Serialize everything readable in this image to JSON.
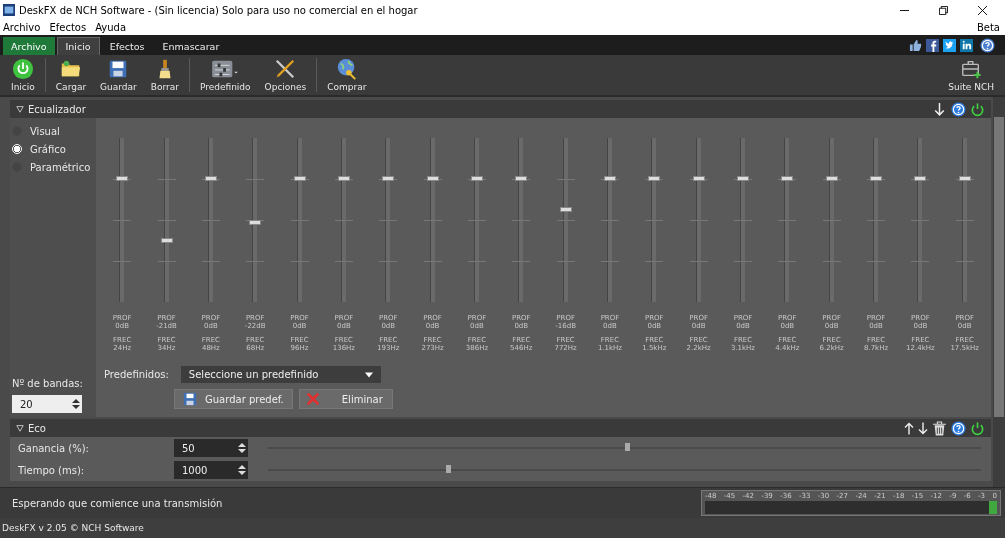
{
  "window": {
    "title": "DeskFX de NCH Software - (Sin licencia) Solo para uso no comercial en el hogar",
    "badge": "Beta"
  },
  "menu": [
    "Archivo",
    "Efectos",
    "Ayuda"
  ],
  "tabs": [
    {
      "label": "Archivo",
      "kind": "file",
      "selected": false
    },
    {
      "label": "Inicio",
      "kind": "tab",
      "selected": true
    },
    {
      "label": "Efectos",
      "kind": "tab",
      "selected": false
    },
    {
      "label": "Enmascarar",
      "kind": "tab",
      "selected": false
    }
  ],
  "toolbar": [
    {
      "label": "Inicio"
    },
    {
      "label": "Cargar"
    },
    {
      "label": "Guardar"
    },
    {
      "label": "Borrar"
    },
    {
      "label": "Predefinido"
    },
    {
      "label": "Opciones"
    },
    {
      "label": "Comprar"
    }
  ],
  "suite": "Suite NCH",
  "equalizer": {
    "title": "Ecualizador",
    "modes": [
      {
        "label": "Visual",
        "selected": false
      },
      {
        "label": "Gráfico",
        "selected": true
      },
      {
        "label": "Paramétrico",
        "selected": false
      }
    ],
    "bands_label": "Nº de bandas:",
    "bands_value": "20",
    "presets_label": "Predefinidos:",
    "presets_placeholder": "Seleccione un predefinido",
    "save_button": "Guardar predef.",
    "delete_button": "Eliminar",
    "bands": [
      {
        "gain_label": "PROF",
        "gain": "0dB",
        "freq_label": "FREC",
        "freq": "24Hz",
        "level": 0.75
      },
      {
        "gain_label": "PROF",
        "gain": "-21dB",
        "freq_label": "FREC",
        "freq": "34Hz",
        "level": 0.37
      },
      {
        "gain_label": "PROF",
        "gain": "0dB",
        "freq_label": "FREC",
        "freq": "48Hz",
        "level": 0.75
      },
      {
        "gain_label": "PROF",
        "gain": "-22dB",
        "freq_label": "FREC",
        "freq": "68Hz",
        "level": 0.48
      },
      {
        "gain_label": "PROF",
        "gain": "0dB",
        "freq_label": "FREC",
        "freq": "96Hz",
        "level": 0.75
      },
      {
        "gain_label": "PROF",
        "gain": "0dB",
        "freq_label": "FREC",
        "freq": "136Hz",
        "level": 0.75
      },
      {
        "gain_label": "PROF",
        "gain": "0dB",
        "freq_label": "FREC",
        "freq": "193Hz",
        "level": 0.75
      },
      {
        "gain_label": "PROF",
        "gain": "0dB",
        "freq_label": "FREC",
        "freq": "273Hz",
        "level": 0.75
      },
      {
        "gain_label": "PROF",
        "gain": "0dB",
        "freq_label": "FREC",
        "freq": "386Hz",
        "level": 0.75
      },
      {
        "gain_label": "PROF",
        "gain": "0dB",
        "freq_label": "FREC",
        "freq": "546Hz",
        "level": 0.75
      },
      {
        "gain_label": "PROF",
        "gain": "-16dB",
        "freq_label": "FREC",
        "freq": "772Hz",
        "level": 0.56
      },
      {
        "gain_label": "PROF",
        "gain": "0dB",
        "freq_label": "FREC",
        "freq": "1.1kHz",
        "level": 0.75
      },
      {
        "gain_label": "PROF",
        "gain": "0dB",
        "freq_label": "FREC",
        "freq": "1.5kHz",
        "level": 0.75
      },
      {
        "gain_label": "PROF",
        "gain": "0dB",
        "freq_label": "FREC",
        "freq": "2.2kHz",
        "level": 0.75
      },
      {
        "gain_label": "PROF",
        "gain": "0dB",
        "freq_label": "FREC",
        "freq": "3.1kHz",
        "level": 0.75
      },
      {
        "gain_label": "PROF",
        "gain": "0dB",
        "freq_label": "FREC",
        "freq": "4.4kHz",
        "level": 0.75
      },
      {
        "gain_label": "PROF",
        "gain": "0dB",
        "freq_label": "FREC",
        "freq": "6.2kHz",
        "level": 0.75
      },
      {
        "gain_label": "PROF",
        "gain": "0dB",
        "freq_label": "FREC",
        "freq": "8.7kHz",
        "level": 0.75
      },
      {
        "gain_label": "PROF",
        "gain": "0dB",
        "freq_label": "FREC",
        "freq": "12.4kHz",
        "level": 0.75
      },
      {
        "gain_label": "PROF",
        "gain": "0dB",
        "freq_label": "FREC",
        "freq": "17.5kHz",
        "level": 0.75
      }
    ]
  },
  "echo": {
    "title": "Eco",
    "rows": [
      {
        "label": "Ganancia (%):",
        "value": "50",
        "level": 0.5
      },
      {
        "label": "Tiempo (ms):",
        "value": "1000",
        "level": 0.25
      }
    ]
  },
  "status": "Esperando que comience una transmisión",
  "meter": {
    "ticks": [
      "-48",
      "-45",
      "-42",
      "-39",
      "-36",
      "-33",
      "-30",
      "-27",
      "-24",
      "-21",
      "-18",
      "-15",
      "-12",
      "-9",
      "-6",
      "-3",
      "0"
    ]
  },
  "footer": "DeskFX v 2.05 © NCH Software"
}
